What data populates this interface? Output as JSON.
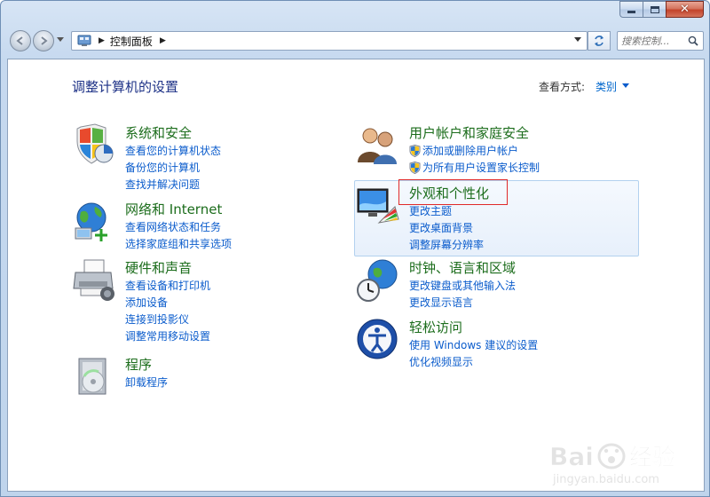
{
  "window": {
    "title_buttons": [
      "minimize",
      "maximize",
      "close"
    ]
  },
  "navbar": {
    "breadcrumb": "控制面板",
    "search_placeholder": "搜索控制..."
  },
  "content": {
    "page_title": "调整计算机的设置",
    "view_by_label": "查看方式:",
    "view_by_value": "类别"
  },
  "categories": {
    "system": {
      "title": "系统和安全",
      "icon": "system-security-shield-icon",
      "links": [
        "查看您的计算机状态",
        "备份您的计算机",
        "查找并解决问题"
      ]
    },
    "network": {
      "title": "网络和 Internet",
      "icon": "network-globe-icon",
      "links": [
        "查看网络状态和任务",
        "选择家庭组和共享选项"
      ]
    },
    "hardware": {
      "title": "硬件和声音",
      "icon": "printer-icon",
      "links": [
        "查看设备和打印机",
        "添加设备",
        "连接到投影仪",
        "调整常用移动设置"
      ]
    },
    "programs": {
      "title": "程序",
      "icon": "programs-disc-icon",
      "links": [
        "卸载程序"
      ]
    },
    "users": {
      "title": "用户帐户和家庭安全",
      "icon": "users-icon",
      "links": [
        "添加或删除用户帐户",
        "为所有用户设置家长控制"
      ]
    },
    "appearance": {
      "title": "外观和个性化",
      "icon": "monitor-palette-icon",
      "links": [
        "更改主题",
        "更改桌面背景",
        "调整屏幕分辨率"
      ]
    },
    "clock": {
      "title": "时钟、语言和区域",
      "icon": "clock-globe-icon",
      "links": [
        "更改键盘或其他输入法",
        "更改显示语言"
      ]
    },
    "ease": {
      "title": "轻松访问",
      "icon": "ease-of-access-icon",
      "links": [
        "使用 Windows 建议的设置",
        "优化视频显示"
      ]
    }
  },
  "watermark": {
    "brand": "Bai 经验",
    "url": "jingyan.baidu.com"
  },
  "colors": {
    "link": "#0b5ccc",
    "category_title": "#1c6d1c",
    "page_title": "#1e3287",
    "highlight_border": "#e02a2a"
  }
}
